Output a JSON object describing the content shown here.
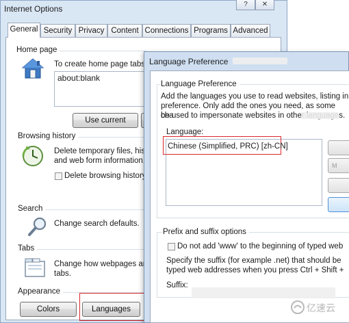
{
  "internet_options": {
    "title": "Internet Options",
    "title_buttons": [
      "?",
      "✕"
    ],
    "tabs": [
      "General",
      "Security",
      "Privacy",
      "Content",
      "Connections",
      "Programs",
      "Advanced"
    ],
    "home_page": {
      "label": "Home page",
      "text": "To create home page tabs,",
      "value": "about:blank",
      "use_current": "Use current"
    },
    "browsing_history": {
      "label": "Browsing history",
      "text_line1": "Delete temporary files, histo",
      "text_line2": "and web form information.",
      "checkbox_label": "Delete browsing history"
    },
    "search": {
      "label": "Search",
      "text": "Change search defaults."
    },
    "tabs_section": {
      "label": "Tabs",
      "text_line1": "Change how webpages are",
      "text_line2": "tabs."
    },
    "appearance": {
      "label": "Appearance",
      "colors_button": "Colors",
      "languages_button": "Languages"
    }
  },
  "language_preference": {
    "title": "Language Preference",
    "group_label": "Language Preference",
    "description_line1": "Add the languages you use to read websites, listing in",
    "description_line2": "preference. Only add the ones you need, as some cha",
    "description_line3": "be used to impersonate websites in other languages.",
    "list_label": "Language:",
    "languages": [
      "Chinese (Simplified, PRC) [zh-CN]"
    ],
    "side_buttons": [
      "M"
    ],
    "prefix_suffix": {
      "label": "Prefix and suffix options",
      "checkbox_label": "Do not add 'www' to the beginning of typed web",
      "text_line1": "Specify the suffix (for example .net) that should be",
      "text_line2": "typed web addresses when you press Ctrl + Shift +",
      "suffix_label": "Suffix:"
    }
  },
  "watermark": {
    "brand": "亿速云"
  },
  "colors": {
    "highlight_red": "#d9262c",
    "window_frame": "#d9e6f4",
    "dialog_frame": "#cfdff1"
  }
}
